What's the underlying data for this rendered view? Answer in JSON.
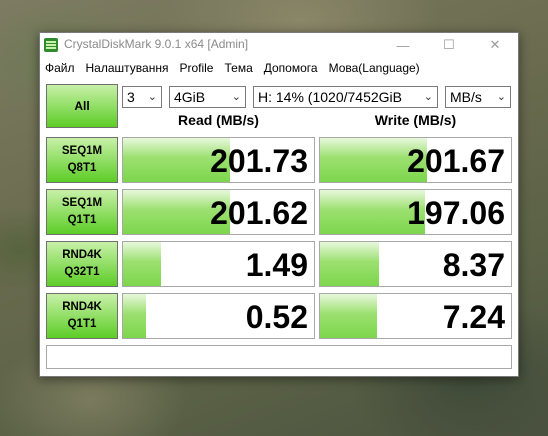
{
  "window": {
    "title": "CrystalDiskMark 9.0.1 x64 [Admin]"
  },
  "titlebar_buttons": {
    "minimize": "—",
    "maximize": "☐",
    "close": "✕"
  },
  "menu": [
    "Файл",
    "Налаштування",
    "Profile",
    "Тема",
    "Допомога",
    "Мова(Language)"
  ],
  "controls": {
    "all_label": "All",
    "count": "3",
    "size": "4GiB",
    "drive": "H: 14% (1020/7452GiB",
    "unit": "MB/s"
  },
  "headers": {
    "read": "Read (MB/s)",
    "write": "Write (MB/s)"
  },
  "rows": [
    {
      "line1": "SEQ1M",
      "line2": "Q8T1",
      "read": "201.73",
      "write": "201.67",
      "read_fill": 0.56,
      "write_fill": 0.56
    },
    {
      "line1": "SEQ1M",
      "line2": "Q1T1",
      "read": "201.62",
      "write": "197.06",
      "read_fill": 0.56,
      "write_fill": 0.55
    },
    {
      "line1": "RND4K",
      "line2": "Q32T1",
      "read": "1.49",
      "write": "8.37",
      "read_fill": 0.2,
      "write_fill": 0.31
    },
    {
      "line1": "RND4K",
      "line2": "Q1T1",
      "read": "0.52",
      "write": "7.24",
      "read_fill": 0.12,
      "write_fill": 0.3
    }
  ],
  "comment": "",
  "colors": {
    "accent_green": "#5ccd26",
    "bar_green": "#7dd64c"
  },
  "icons": {
    "app": "crystaldiskmark-icon",
    "dropdown": "chevron-down-icon"
  }
}
